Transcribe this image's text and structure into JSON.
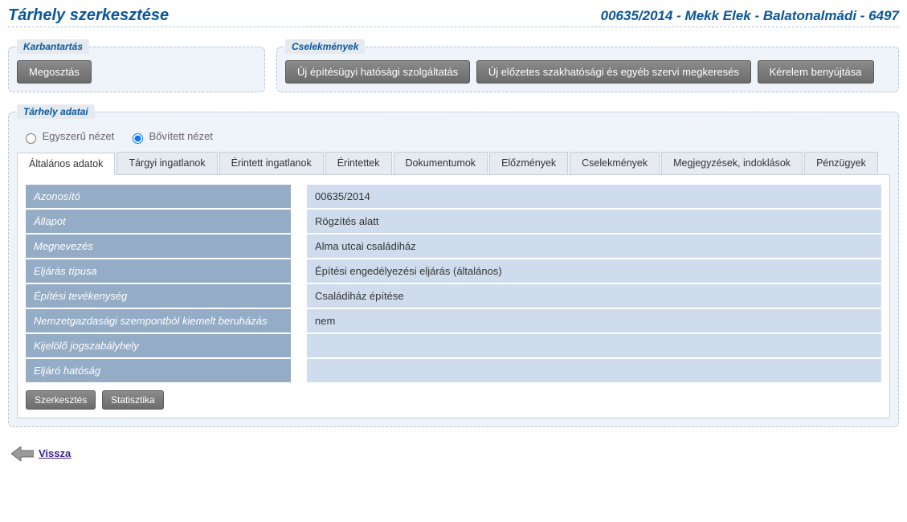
{
  "header": {
    "page_title": "Tárhely szerkesztése",
    "case_id": "00635/2014 - Mekk Elek - Balatonalmádi - 6497"
  },
  "karbantartas": {
    "legend": "Karbantartás",
    "buttons": {
      "share": "Megosztás"
    }
  },
  "cselekmenyek": {
    "legend": "Cselekmények",
    "buttons": {
      "new_service": "Új építésügyi hatósági szolgáltatás",
      "new_inquiry": "Új előzetes szakhatósági és egyéb szervi megkeresés",
      "submit_request": "Kérelem benyújtása"
    }
  },
  "tarhely": {
    "legend": "Tárhely adatai",
    "view": {
      "simple": "Egyszerű nézet",
      "extended": "Bővített nézet",
      "selected": "extended"
    },
    "tabs": [
      {
        "id": "altalanos",
        "label": "Általános adatok"
      },
      {
        "id": "targyi",
        "label": "Tárgyi ingatlanok"
      },
      {
        "id": "erintett_ingatlanok",
        "label": "Érintett ingatlanok"
      },
      {
        "id": "erintettek",
        "label": "Érintettek"
      },
      {
        "id": "dokumentumok",
        "label": "Dokumentumok"
      },
      {
        "id": "elozmenyek",
        "label": "Előzmények"
      },
      {
        "id": "cselekmenyek",
        "label": "Cselekmények"
      },
      {
        "id": "megjegyzesek",
        "label": "Megjegyzések, indoklások"
      },
      {
        "id": "penzugyek",
        "label": "Pénzügyek"
      }
    ],
    "active_tab": "altalanos",
    "fields": [
      {
        "label": "Azonosító",
        "value": "00635/2014"
      },
      {
        "label": "Állapot",
        "value": "Rögzítés alatt"
      },
      {
        "label": "Megnevezés",
        "value": "Alma utcai családiház"
      },
      {
        "label": "Eljárás típusa",
        "value": "Építési engedélyezési eljárás (általános)"
      },
      {
        "label": "Építési tevékenység",
        "value": "Családiház építése"
      },
      {
        "label": "Nemzetgazdasági szempontból kiemelt beruházás",
        "value": "nem"
      },
      {
        "label": "Kijelölő jogszabályhely",
        "value": ""
      },
      {
        "label": "Eljáró hatóság",
        "value": ""
      }
    ],
    "panel_actions": {
      "edit": "Szerkesztés",
      "stats": "Statisztika"
    }
  },
  "back": {
    "label": "Vissza"
  }
}
